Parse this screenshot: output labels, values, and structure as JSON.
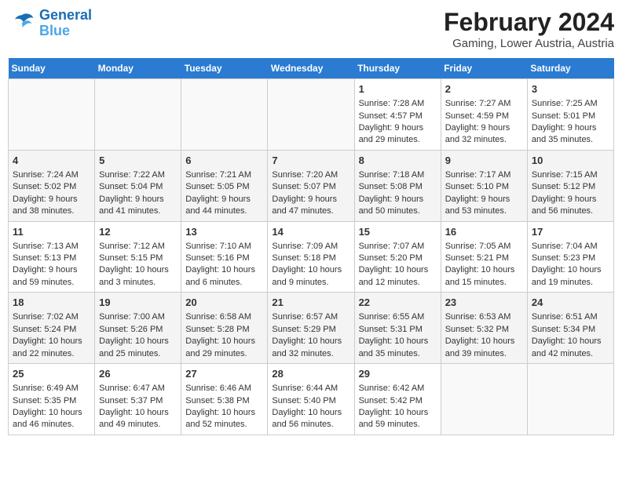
{
  "header": {
    "logo_line1": "General",
    "logo_line2": "Blue",
    "title": "February 2024",
    "subtitle": "Gaming, Lower Austria, Austria"
  },
  "days_of_week": [
    "Sunday",
    "Monday",
    "Tuesday",
    "Wednesday",
    "Thursday",
    "Friday",
    "Saturday"
  ],
  "weeks": [
    [
      {
        "day": "",
        "empty": true
      },
      {
        "day": "",
        "empty": true
      },
      {
        "day": "",
        "empty": true
      },
      {
        "day": "",
        "empty": true
      },
      {
        "day": "1",
        "line1": "Sunrise: 7:28 AM",
        "line2": "Sunset: 4:57 PM",
        "line3": "Daylight: 9 hours",
        "line4": "and 29 minutes."
      },
      {
        "day": "2",
        "line1": "Sunrise: 7:27 AM",
        "line2": "Sunset: 4:59 PM",
        "line3": "Daylight: 9 hours",
        "line4": "and 32 minutes."
      },
      {
        "day": "3",
        "line1": "Sunrise: 7:25 AM",
        "line2": "Sunset: 5:01 PM",
        "line3": "Daylight: 9 hours",
        "line4": "and 35 minutes."
      }
    ],
    [
      {
        "day": "4",
        "line1": "Sunrise: 7:24 AM",
        "line2": "Sunset: 5:02 PM",
        "line3": "Daylight: 9 hours",
        "line4": "and 38 minutes."
      },
      {
        "day": "5",
        "line1": "Sunrise: 7:22 AM",
        "line2": "Sunset: 5:04 PM",
        "line3": "Daylight: 9 hours",
        "line4": "and 41 minutes."
      },
      {
        "day": "6",
        "line1": "Sunrise: 7:21 AM",
        "line2": "Sunset: 5:05 PM",
        "line3": "Daylight: 9 hours",
        "line4": "and 44 minutes."
      },
      {
        "day": "7",
        "line1": "Sunrise: 7:20 AM",
        "line2": "Sunset: 5:07 PM",
        "line3": "Daylight: 9 hours",
        "line4": "and 47 minutes."
      },
      {
        "day": "8",
        "line1": "Sunrise: 7:18 AM",
        "line2": "Sunset: 5:08 PM",
        "line3": "Daylight: 9 hours",
        "line4": "and 50 minutes."
      },
      {
        "day": "9",
        "line1": "Sunrise: 7:17 AM",
        "line2": "Sunset: 5:10 PM",
        "line3": "Daylight: 9 hours",
        "line4": "and 53 minutes."
      },
      {
        "day": "10",
        "line1": "Sunrise: 7:15 AM",
        "line2": "Sunset: 5:12 PM",
        "line3": "Daylight: 9 hours",
        "line4": "and 56 minutes."
      }
    ],
    [
      {
        "day": "11",
        "line1": "Sunrise: 7:13 AM",
        "line2": "Sunset: 5:13 PM",
        "line3": "Daylight: 9 hours",
        "line4": "and 59 minutes."
      },
      {
        "day": "12",
        "line1": "Sunrise: 7:12 AM",
        "line2": "Sunset: 5:15 PM",
        "line3": "Daylight: 10 hours",
        "line4": "and 3 minutes."
      },
      {
        "day": "13",
        "line1": "Sunrise: 7:10 AM",
        "line2": "Sunset: 5:16 PM",
        "line3": "Daylight: 10 hours",
        "line4": "and 6 minutes."
      },
      {
        "day": "14",
        "line1": "Sunrise: 7:09 AM",
        "line2": "Sunset: 5:18 PM",
        "line3": "Daylight: 10 hours",
        "line4": "and 9 minutes."
      },
      {
        "day": "15",
        "line1": "Sunrise: 7:07 AM",
        "line2": "Sunset: 5:20 PM",
        "line3": "Daylight: 10 hours",
        "line4": "and 12 minutes."
      },
      {
        "day": "16",
        "line1": "Sunrise: 7:05 AM",
        "line2": "Sunset: 5:21 PM",
        "line3": "Daylight: 10 hours",
        "line4": "and 15 minutes."
      },
      {
        "day": "17",
        "line1": "Sunrise: 7:04 AM",
        "line2": "Sunset: 5:23 PM",
        "line3": "Daylight: 10 hours",
        "line4": "and 19 minutes."
      }
    ],
    [
      {
        "day": "18",
        "line1": "Sunrise: 7:02 AM",
        "line2": "Sunset: 5:24 PM",
        "line3": "Daylight: 10 hours",
        "line4": "and 22 minutes."
      },
      {
        "day": "19",
        "line1": "Sunrise: 7:00 AM",
        "line2": "Sunset: 5:26 PM",
        "line3": "Daylight: 10 hours",
        "line4": "and 25 minutes."
      },
      {
        "day": "20",
        "line1": "Sunrise: 6:58 AM",
        "line2": "Sunset: 5:28 PM",
        "line3": "Daylight: 10 hours",
        "line4": "and 29 minutes."
      },
      {
        "day": "21",
        "line1": "Sunrise: 6:57 AM",
        "line2": "Sunset: 5:29 PM",
        "line3": "Daylight: 10 hours",
        "line4": "and 32 minutes."
      },
      {
        "day": "22",
        "line1": "Sunrise: 6:55 AM",
        "line2": "Sunset: 5:31 PM",
        "line3": "Daylight: 10 hours",
        "line4": "and 35 minutes."
      },
      {
        "day": "23",
        "line1": "Sunrise: 6:53 AM",
        "line2": "Sunset: 5:32 PM",
        "line3": "Daylight: 10 hours",
        "line4": "and 39 minutes."
      },
      {
        "day": "24",
        "line1": "Sunrise: 6:51 AM",
        "line2": "Sunset: 5:34 PM",
        "line3": "Daylight: 10 hours",
        "line4": "and 42 minutes."
      }
    ],
    [
      {
        "day": "25",
        "line1": "Sunrise: 6:49 AM",
        "line2": "Sunset: 5:35 PM",
        "line3": "Daylight: 10 hours",
        "line4": "and 46 minutes."
      },
      {
        "day": "26",
        "line1": "Sunrise: 6:47 AM",
        "line2": "Sunset: 5:37 PM",
        "line3": "Daylight: 10 hours",
        "line4": "and 49 minutes."
      },
      {
        "day": "27",
        "line1": "Sunrise: 6:46 AM",
        "line2": "Sunset: 5:38 PM",
        "line3": "Daylight: 10 hours",
        "line4": "and 52 minutes."
      },
      {
        "day": "28",
        "line1": "Sunrise: 6:44 AM",
        "line2": "Sunset: 5:40 PM",
        "line3": "Daylight: 10 hours",
        "line4": "and 56 minutes."
      },
      {
        "day": "29",
        "line1": "Sunrise: 6:42 AM",
        "line2": "Sunset: 5:42 PM",
        "line3": "Daylight: 10 hours",
        "line4": "and 59 minutes."
      },
      {
        "day": "",
        "empty": true
      },
      {
        "day": "",
        "empty": true
      }
    ]
  ]
}
